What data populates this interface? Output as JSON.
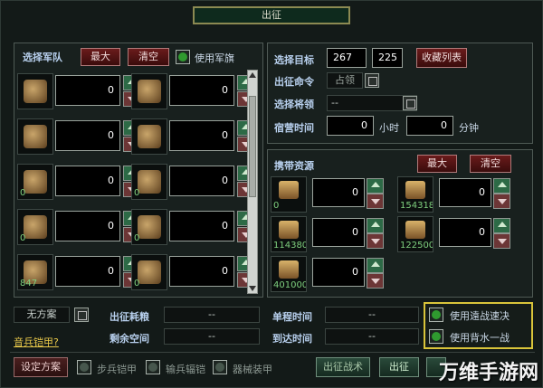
{
  "title": "出征",
  "troops": {
    "heading": "选择军队",
    "max_label": "最大",
    "clear_label": "清空",
    "use_flag_label": "使用军旗",
    "slots": [
      {
        "icon": "spear-icon",
        "value": "0",
        "count": ""
      },
      {
        "icon": "trident-icon",
        "value": "0",
        "count": ""
      },
      {
        "icon": "sword-icon",
        "value": "0",
        "count": ""
      },
      {
        "icon": "halberd-icon",
        "value": "0",
        "count": ""
      },
      {
        "icon": "shield-icon",
        "value": "0",
        "count": "0"
      },
      {
        "icon": "bow-icon",
        "value": "0",
        "count": "0"
      },
      {
        "icon": "horse-icon",
        "value": "0",
        "count": "0"
      },
      {
        "icon": "armored-horse-icon",
        "value": "0",
        "count": "0"
      },
      {
        "icon": "ram-icon",
        "value": "0",
        "count": "847"
      },
      {
        "icon": "crossbow-icon",
        "value": "0",
        "count": "0"
      }
    ]
  },
  "target": {
    "select_label": "选择目标",
    "x": "267",
    "y": "225",
    "favorites_label": "收藏列表",
    "command_label": "出征命令",
    "command_value": "占领",
    "general_label": "选择将领",
    "general_value": "--",
    "camp_label": "宿营时间",
    "hours_value": "0",
    "hours_unit": "小时",
    "minutes_value": "0",
    "minutes_unit": "分钟"
  },
  "resources": {
    "heading": "携带资源",
    "max_label": "最大",
    "clear_label": "清空",
    "items": [
      {
        "icon": "grain-icon",
        "count": "0",
        "value": "0"
      },
      {
        "icon": "wood-icon",
        "count": "154318",
        "value": "0"
      },
      {
        "icon": "stone-icon",
        "count": "114380",
        "value": "0"
      },
      {
        "icon": "iron-icon",
        "count": "122500",
        "value": "0"
      },
      {
        "icon": "gold-icon",
        "count": "401000",
        "value": "0"
      }
    ]
  },
  "plan": {
    "value": "无方案"
  },
  "stats": {
    "cost_label": "出征耗粮",
    "cost_value": "--",
    "space_label": "剩余空间",
    "space_value": "--",
    "one_way_label": "单程时间",
    "one_way_value": "--",
    "arrival_label": "到达时间",
    "arrival_value": "--"
  },
  "link_label": "音兵铠甲?",
  "options": {
    "ranged_label": "使用遠战速决",
    "backwater_label": "使用背水一战"
  },
  "bottom": {
    "set_plan_label": "设定方案",
    "infantry_armor_label": "步兵铠甲",
    "transport_armor_label": "输兵辐铠",
    "siege_armor_label": "器械装甲",
    "tactics_label": "出征战术",
    "march_label": "出征"
  },
  "watermark": "万维手游网"
}
